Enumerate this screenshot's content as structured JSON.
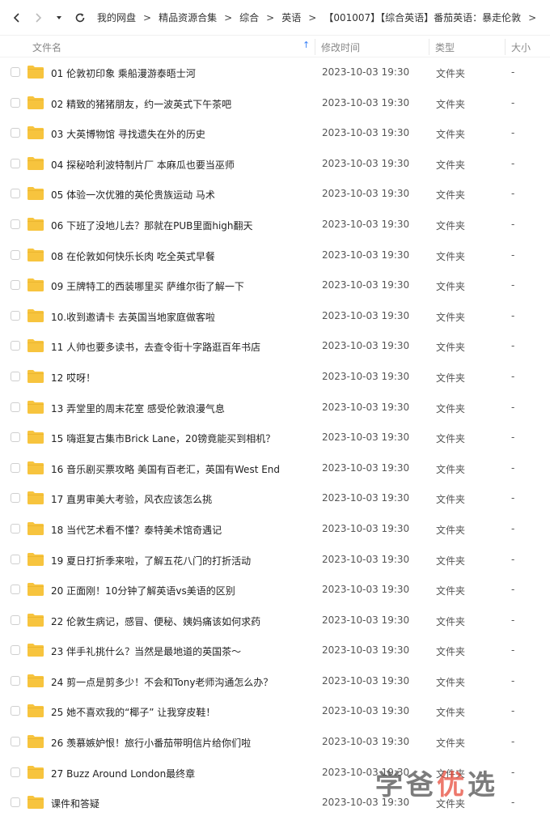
{
  "breadcrumb": [
    "我的网盘",
    "精品资源合集",
    "综合",
    "英语",
    "【001007】【综合英语】番茄英语：暴走伦敦"
  ],
  "columns": {
    "name": "文件名",
    "time": "修改时间",
    "type": "类型",
    "size": "大小"
  },
  "colors": {
    "folder": "#F7C43E",
    "accent": "#3B82F6"
  },
  "rows": [
    {
      "name": "01 伦敦初印象 乘船漫游泰晤士河",
      "time": "2023-10-03 19:30",
      "type": "文件夹",
      "size": "-"
    },
    {
      "name": "02 精致的猪猪朋友，约一波英式下午茶吧",
      "time": "2023-10-03 19:30",
      "type": "文件夹",
      "size": "-"
    },
    {
      "name": "03 大英博物馆 寻找遗失在外的历史",
      "time": "2023-10-03 19:30",
      "type": "文件夹",
      "size": "-"
    },
    {
      "name": "04 探秘哈利波特制片厂 本麻瓜也要当巫师",
      "time": "2023-10-03 19:30",
      "type": "文件夹",
      "size": "-"
    },
    {
      "name": "05 体验一次优雅的英伦贵族运动 马术",
      "time": "2023-10-03 19:30",
      "type": "文件夹",
      "size": "-"
    },
    {
      "name": "06 下班了没地儿去？那就在PUB里面high翻天",
      "time": "2023-10-03 19:30",
      "type": "文件夹",
      "size": "-"
    },
    {
      "name": "08 在伦敦如何快乐长肉 吃全英式早餐",
      "time": "2023-10-03 19:30",
      "type": "文件夹",
      "size": "-"
    },
    {
      "name": "09 王牌特工的西装哪里买 萨维尔街了解一下",
      "time": "2023-10-03 19:30",
      "type": "文件夹",
      "size": "-"
    },
    {
      "name": "10.收到邀请卡 去英国当地家庭做客啦",
      "time": "2023-10-03 19:30",
      "type": "文件夹",
      "size": "-"
    },
    {
      "name": "11 人帅也要多读书，去查令街十字路逛百年书店",
      "time": "2023-10-03 19:30",
      "type": "文件夹",
      "size": "-"
    },
    {
      "name": "12 哎呀！",
      "time": "2023-10-03 19:30",
      "type": "文件夹",
      "size": "-"
    },
    {
      "name": "13 弄堂里的周末花室 感受伦敦浪漫气息",
      "time": "2023-10-03 19:30",
      "type": "文件夹",
      "size": "-"
    },
    {
      "name": "15 嗨逛复古集市Brick Lane，20镑竟能买到相机？",
      "time": "2023-10-03 19:30",
      "type": "文件夹",
      "size": "-"
    },
    {
      "name": "16 音乐剧买票攻略 美国有百老汇，英国有West End",
      "time": "2023-10-03 19:30",
      "type": "文件夹",
      "size": "-"
    },
    {
      "name": "17 直男审美大考验，风衣应该怎么挑",
      "time": "2023-10-03 19:30",
      "type": "文件夹",
      "size": "-"
    },
    {
      "name": "18 当代艺术看不懂？泰特美术馆奇遇记",
      "time": "2023-10-03 19:30",
      "type": "文件夹",
      "size": "-"
    },
    {
      "name": "19 夏日打折季来啦，了解五花八门的打折活动",
      "time": "2023-10-03 19:30",
      "type": "文件夹",
      "size": "-"
    },
    {
      "name": "20 正面刚！10分钟了解英语vs美语的区别",
      "time": "2023-10-03 19:30",
      "type": "文件夹",
      "size": "-"
    },
    {
      "name": "22 伦敦生病记，感冒、便秘、姨妈痛该如何求药",
      "time": "2023-10-03 19:30",
      "type": "文件夹",
      "size": "-"
    },
    {
      "name": "23 伴手礼挑什么？当然是最地道的英国茶～",
      "time": "2023-10-03 19:30",
      "type": "文件夹",
      "size": "-"
    },
    {
      "name": "24 剪一点是剪多少！不会和Tony老师沟通怎么办？",
      "time": "2023-10-03 19:30",
      "type": "文件夹",
      "size": "-"
    },
    {
      "name": "25 她不喜欢我的“椰子” 让我穿皮鞋！",
      "time": "2023-10-03 19:30",
      "type": "文件夹",
      "size": "-"
    },
    {
      "name": "26 羡慕嫉妒恨！旅行小番茄带明信片给你们啦",
      "time": "2023-10-03 19:30",
      "type": "文件夹",
      "size": "-"
    },
    {
      "name": "27 Buzz Around London最终章",
      "time": "2023-10-03 19:30",
      "type": "文件夹",
      "size": "-"
    },
    {
      "name": "课件和答疑",
      "time": "2023-10-03 19:30",
      "type": "文件夹",
      "size": "-"
    }
  ],
  "watermark": {
    "part1": "学爸",
    "part2": "优",
    "part3": "选"
  }
}
